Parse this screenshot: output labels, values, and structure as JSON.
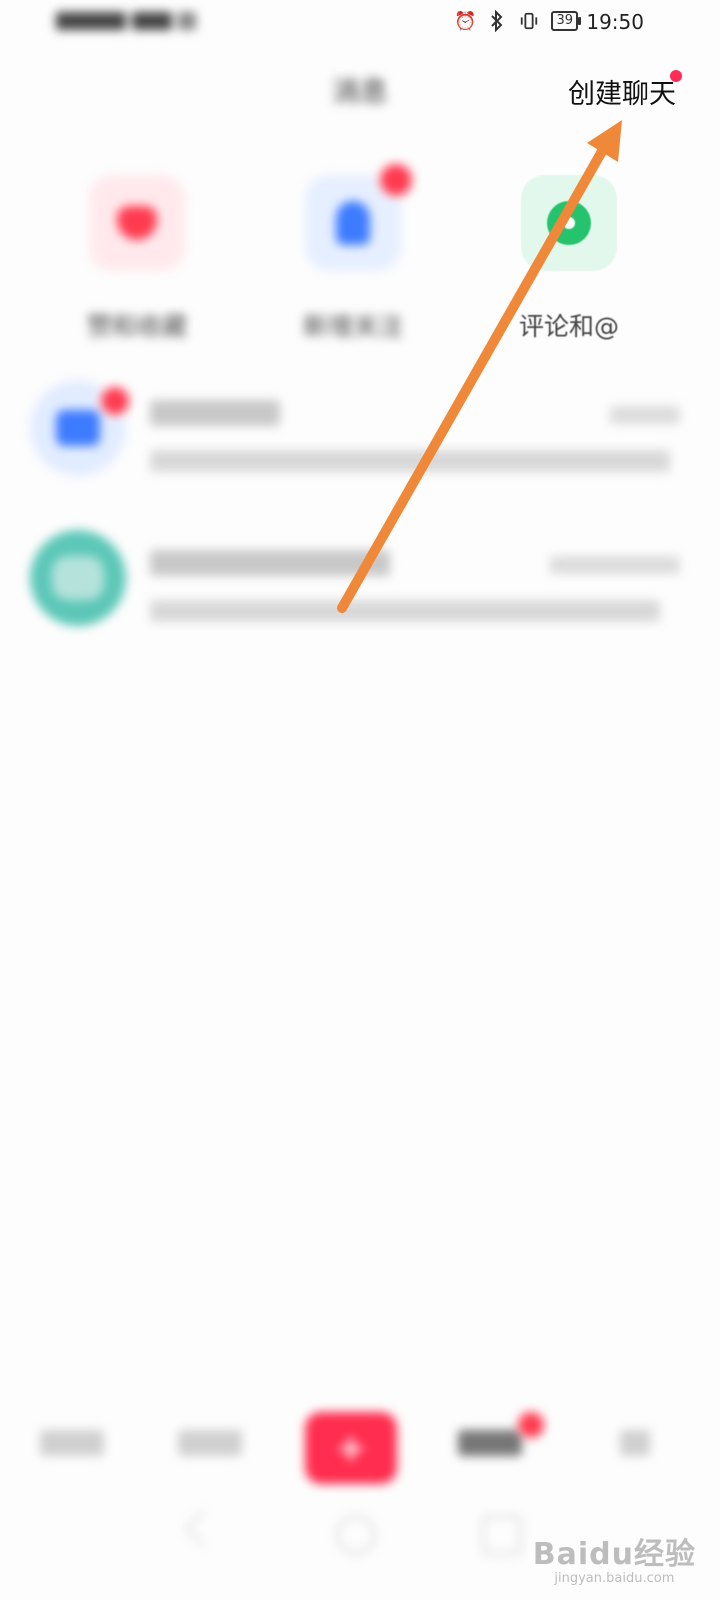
{
  "status_bar": {
    "time": "19:50",
    "battery": "39",
    "icons": [
      "alarm-icon",
      "bluetooth-icon",
      "vibrate-icon",
      "battery-icon"
    ]
  },
  "header": {
    "title": "消息",
    "create_chat_label": "创建聊天"
  },
  "quick_entries": [
    {
      "icon": "heart-icon",
      "label": "赞和收藏"
    },
    {
      "icon": "person-icon",
      "label": "新增关注"
    },
    {
      "icon": "comment-icon",
      "label": "评论和@"
    }
  ],
  "bottom_nav": {
    "publish_icon": "plus-icon"
  },
  "watermark": {
    "brand": "Baidu经验",
    "url": "jingyan.baidu.com"
  },
  "colors": {
    "accent_red": "#ff2d4f",
    "arrow_orange": "#f0883a"
  }
}
